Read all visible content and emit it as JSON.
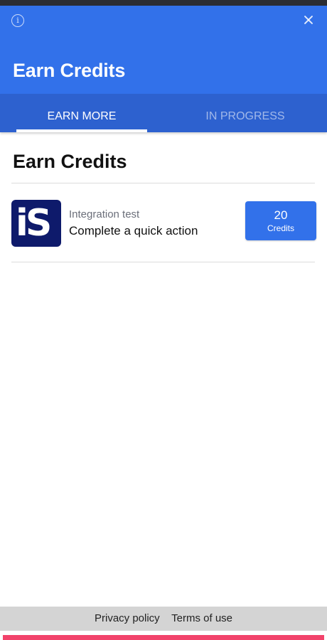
{
  "header": {
    "title": "Earn Credits",
    "info_icon": "info-icon",
    "close_icon": "close-icon"
  },
  "tabs": [
    {
      "label": "EARN MORE",
      "active": true
    },
    {
      "label": "IN PROGRESS",
      "active": false
    }
  ],
  "main": {
    "section_title": "Earn Credits",
    "offers": [
      {
        "logo_text": "iS",
        "provider": "Integration test",
        "description": "Complete a quick action",
        "credits_amount": "20",
        "credits_label": "Credits"
      }
    ]
  },
  "footer": {
    "privacy_label": "Privacy policy",
    "terms_label": "Terms of use"
  },
  "colors": {
    "primary": "#3271ea",
    "tab_bar": "#2d61cf",
    "logo_bg": "#0e1a6b",
    "accent_bottom": "#f2436b"
  }
}
